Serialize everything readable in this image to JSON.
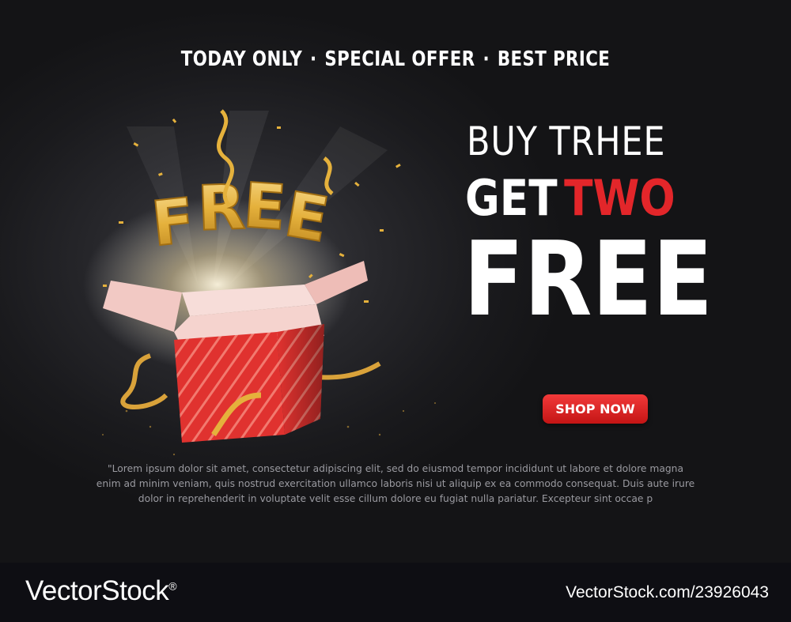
{
  "banner": {
    "tagline": [
      "TODAY ONLY",
      "SPECIAL OFFER",
      "BEST PRICE"
    ],
    "tagline_separator": "·",
    "headline_line1": "BUY TRHEE",
    "headline_get": "GET",
    "headline_two": "TWO",
    "headline_free": "FREE",
    "gift_letters": [
      "F",
      "R",
      "E",
      "E"
    ],
    "cta_label": "SHOP NOW",
    "body_text": "\"Lorem ipsum dolor sit amet, consectetur adipiscing elit, sed do eiusmod tempor incididunt ut labore et dolore magna enim ad minim veniam, quis nostrud exercitation ullamco laboris nisi ut aliquip ex ea commodo consequat. Duis aute irure dolor in reprehenderit in voluptate velit esse cillum dolore eu fugiat nulla pariatur. Excepteur sint occae p",
    "colors": {
      "accent_red": "#e3262a",
      "gold": "#e5b13c",
      "box_red": "#e0322f",
      "lid_pink": "#f2c9c4"
    }
  },
  "footer": {
    "brand": "VectorStock",
    "brand_mark": "®",
    "url": "VectorStock.com/23926043"
  }
}
